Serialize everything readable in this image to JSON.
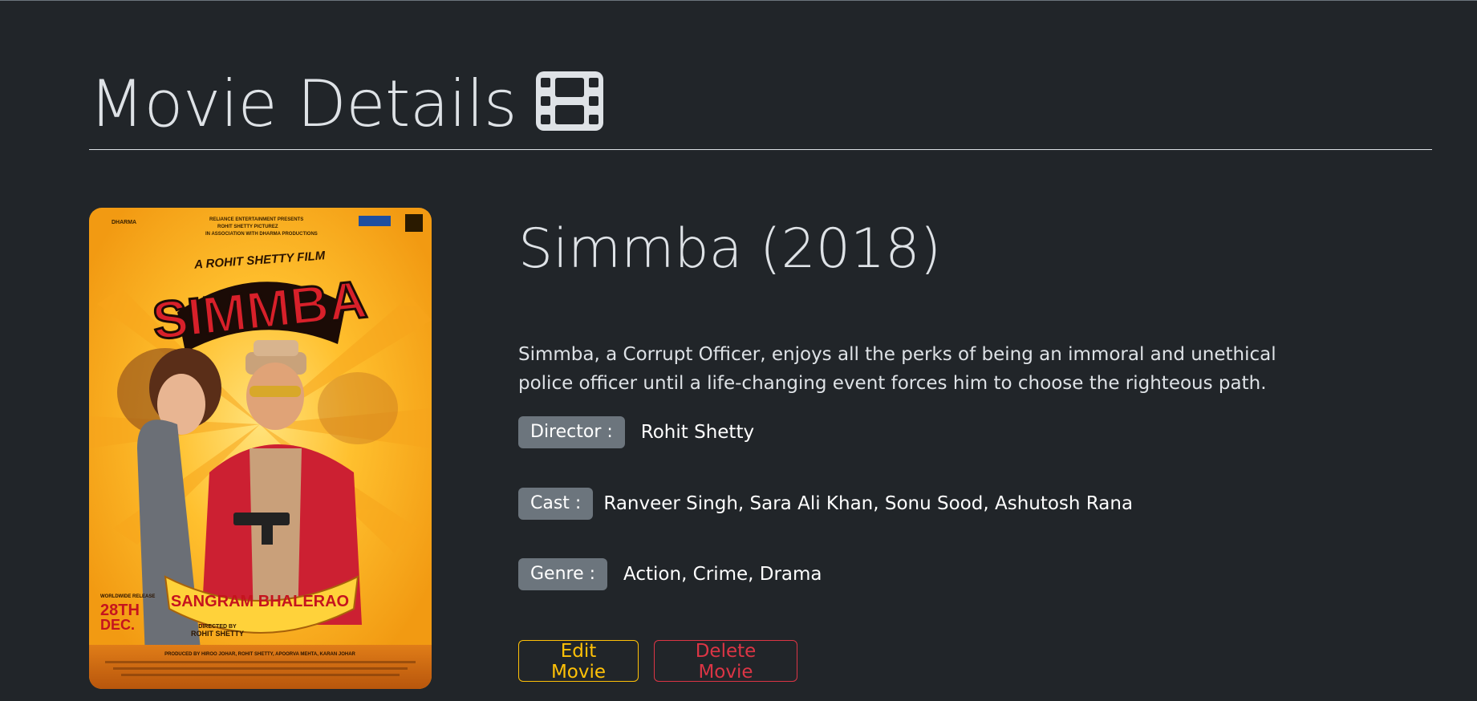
{
  "header": {
    "title": "Movie Details",
    "icon": "film-icon"
  },
  "movie": {
    "title": "Simmba (2018)",
    "description": "Simmba, a Corrupt Officer, enjoys all the perks of being an immoral and unethical police officer until a life-changing event forces him to choose the righteous path.",
    "director_label": "Director :",
    "director": "Rohit Shetty",
    "cast_label": "Cast :",
    "cast": "Ranveer Singh, Sara Ali Khan, Sonu Sood, Ashutosh Rana",
    "genre_label": "Genre :",
    "genre": "Action, Crime, Drama",
    "poster": {
      "main_title": "SIMMBA",
      "tagline": "A ROHIT SHETTY FILM",
      "banner": "SANGRAM BHALERAO",
      "release": "28TH DEC.",
      "release_label": "WORLDWIDE RELEASE",
      "directed_by": "DIRECTED BY",
      "director_name": "ROHIT SHETTY"
    }
  },
  "actions": {
    "edit_label": "Edit Movie",
    "delete_label": "Delete Movie"
  },
  "colors": {
    "background": "#212529",
    "badge": "#6c757d",
    "edit": "#ffc107",
    "delete": "#dc3545"
  }
}
